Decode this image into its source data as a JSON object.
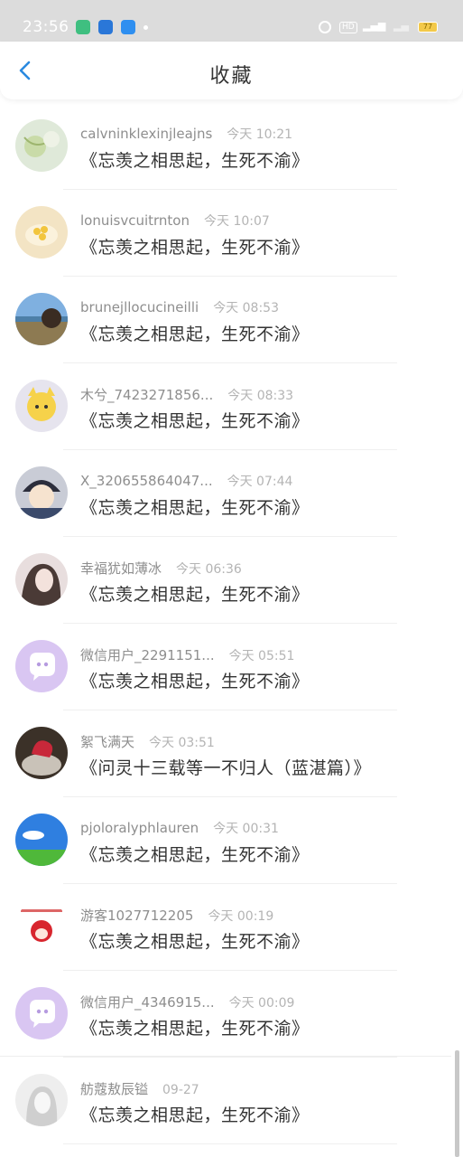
{
  "status_bar": {
    "time": "23:56",
    "battery": "77"
  },
  "header": {
    "title": "收藏"
  },
  "items": [
    {
      "name": "calvninklexinjleajns",
      "time": "今天 10:21",
      "text": "《忘羡之相思起，生死不渝》",
      "avatar": "leaf"
    },
    {
      "name": "lonuisvcuitrnton",
      "time": "今天 10:07",
      "text": "《忘羡之相思起，生死不渝》",
      "avatar": "food"
    },
    {
      "name": "brunejllocucineilli",
      "time": "今天 08:53",
      "text": "《忘羡之相思起，生死不渝》",
      "avatar": "lake"
    },
    {
      "name": "木兮_7423271856...",
      "time": "今天 08:33",
      "text": "《忘羡之相思起，生死不渝》",
      "avatar": "cartoon-yellow"
    },
    {
      "name": "X_320655864047...",
      "time": "今天 07:44",
      "text": "《忘羡之相思起，生死不渝》",
      "avatar": "anime-boy"
    },
    {
      "name": "幸福犹如薄冰",
      "time": "今天 06:36",
      "text": "《忘羡之相思起，生死不渝》",
      "avatar": "girl-photo"
    },
    {
      "name": "微信用户_2291151...",
      "time": "今天 05:51",
      "text": "《忘羡之相思起，生死不渝》",
      "avatar": "default-chat"
    },
    {
      "name": "絮飞满天",
      "time": "今天 03:51",
      "text": "《问灵十三载等一不归人（蓝湛篇）》",
      "avatar": "cake"
    },
    {
      "name": "pjoloralyphlauren",
      "time": "今天 00:31",
      "text": "《忘羡之相思起，生死不渝》",
      "avatar": "sky-field"
    },
    {
      "name": "游客1027712205",
      "time": "今天 00:19",
      "text": "《忘羡之相思起，生死不渝》",
      "avatar": "red-cartoon"
    },
    {
      "name": "微信用户_4346915...",
      "time": "今天 00:09",
      "text": "《忘羡之相思起，生死不渝》",
      "avatar": "default-chat"
    },
    {
      "name": "舫蔻敖辰镒",
      "time": "09-27",
      "text": "《忘羡之相思起，生死不渝》",
      "avatar": "sketch-girl"
    }
  ],
  "colors": {
    "accent": "#2a8ae0",
    "title": "#333333",
    "meta": "#9a9a9a",
    "default_avatar_bg": "#d9c6f2"
  }
}
